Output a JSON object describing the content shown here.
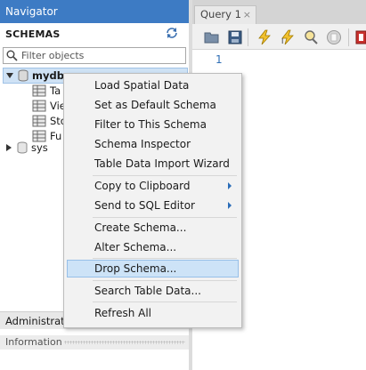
{
  "navigator": {
    "title": "Navigator",
    "schemas_label": "SCHEMAS",
    "filter_placeholder": "Filter objects",
    "tree": {
      "mydb": "mydb",
      "children": [
        "Ta",
        "Vie",
        "Sto",
        "Fu"
      ],
      "sys": "sys"
    },
    "administration_tab": "Administration",
    "information_label": "Information"
  },
  "editor": {
    "tab_title": "Query 1",
    "tab_close": "×",
    "line_numbers": [
      "1"
    ]
  },
  "toolbar": {
    "icons": [
      "open-folder-icon",
      "save-icon",
      "execute-icon",
      "execute-current-icon",
      "explain-icon",
      "stop-icon",
      "toggle-icon"
    ]
  },
  "context_menu": {
    "items": [
      "Load Spatial Data",
      "Set as Default Schema",
      "Filter to This Schema",
      "Schema Inspector",
      "Table Data Import Wizard",
      "Copy to Clipboard",
      "Send to SQL Editor",
      "Create Schema...",
      "Alter Schema...",
      "Drop Schema...",
      "Search Table Data...",
      "Refresh All"
    ],
    "highlighted": "Drop Schema..."
  },
  "colors": {
    "header_blue": "#3d7bc4",
    "highlight": "#cde3f7",
    "accent_arrow": "#2a6db8"
  }
}
